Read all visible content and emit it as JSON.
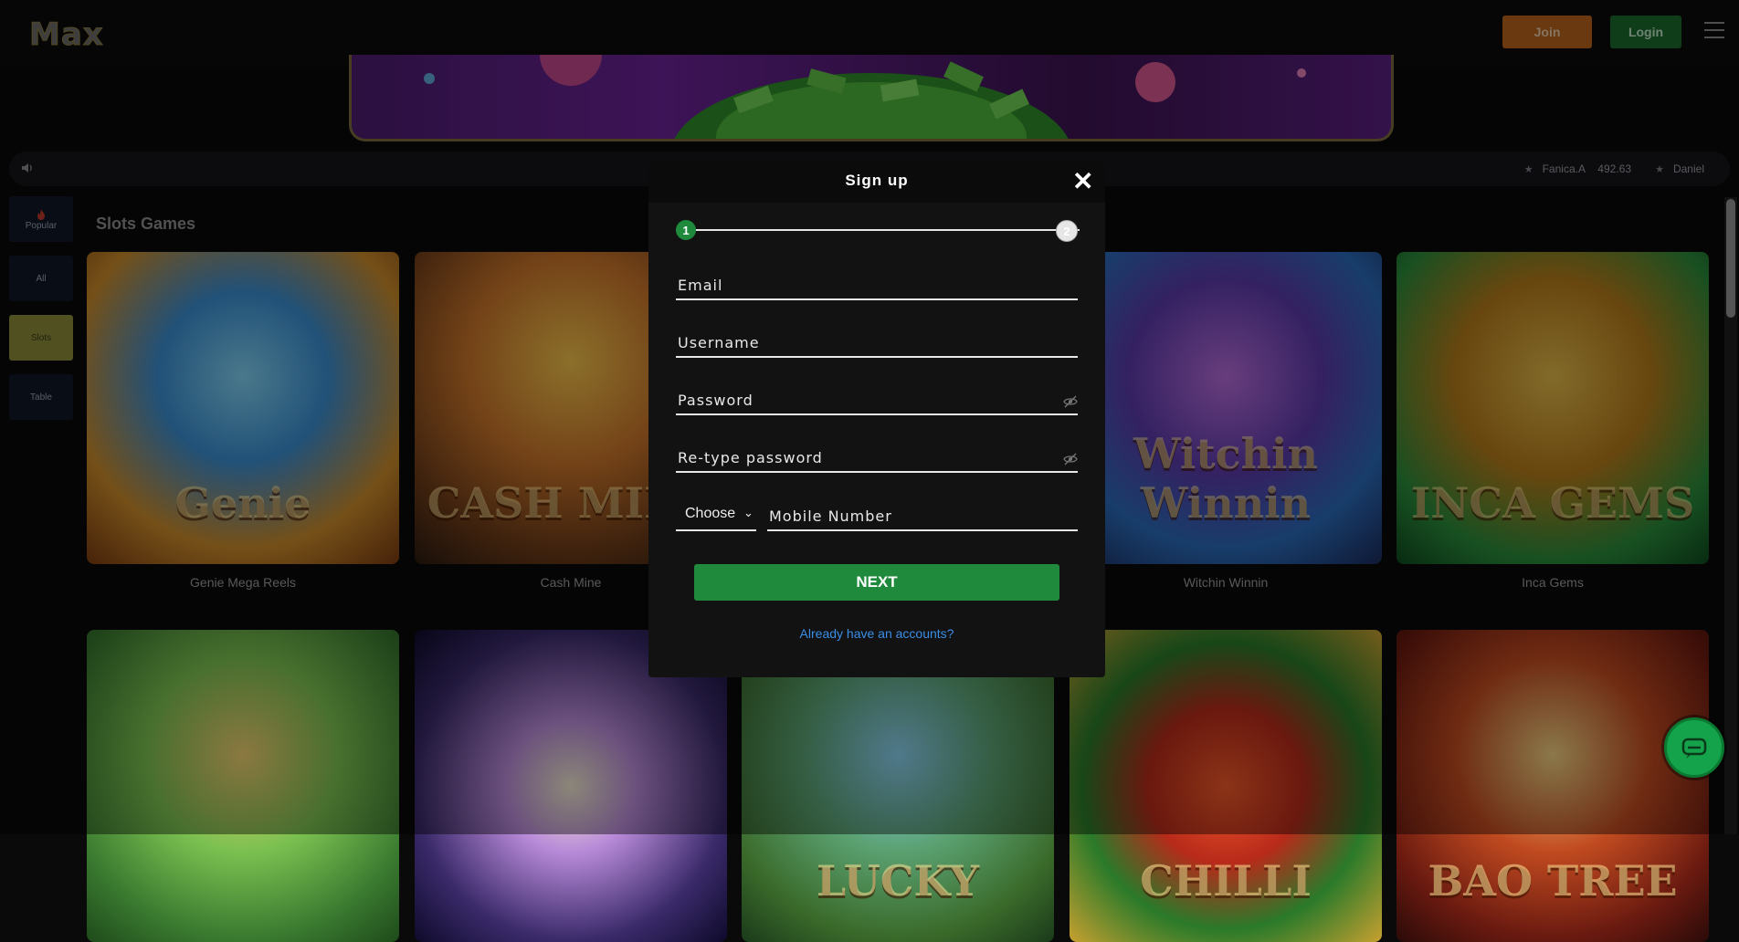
{
  "header": {
    "logo": "Max",
    "join_label": "Join",
    "login_label": "Login"
  },
  "ticker": {
    "entries": [
      {
        "name": "Fanica.A",
        "amount": "492.63"
      },
      {
        "name": "Daniel"
      }
    ]
  },
  "sidebar": {
    "items": [
      {
        "label": "Popular",
        "active": false
      },
      {
        "label": "All",
        "active": false
      },
      {
        "label": "Slots",
        "active": true
      },
      {
        "label": "Table",
        "active": false
      }
    ]
  },
  "section_title": "Slots Games",
  "games": [
    {
      "name": "Genie Mega Reels",
      "art": "Genie"
    },
    {
      "name": "Cash Mine",
      "art": "CASH MINE"
    },
    {
      "name": "",
      "art": ""
    },
    {
      "name": "Witchin Winnin",
      "art": "Witchin Winnin"
    },
    {
      "name": "Inca Gems",
      "art": "INCA GEMS"
    }
  ],
  "games_row2": [
    {
      "art": ""
    },
    {
      "art": ""
    },
    {
      "art": "LUCKY"
    },
    {
      "art": "CHILLI"
    },
    {
      "art": "BAO TREE"
    }
  ],
  "modal": {
    "title": "Sign up",
    "step1": "1",
    "step2": "2",
    "email_placeholder": "Email",
    "username_placeholder": "Username",
    "password_placeholder": "Password",
    "retype_placeholder": "Re-type password",
    "country_select": "Choose",
    "mobile_placeholder": "Mobile Number",
    "next_label": "NEXT",
    "login_link": "Already have an accounts?"
  },
  "colors": {
    "join": "#b8631c",
    "login": "#1b6a2c",
    "next": "#1f8a3b",
    "link": "#3a8ee6",
    "active_tab": "#8a8a3a"
  }
}
